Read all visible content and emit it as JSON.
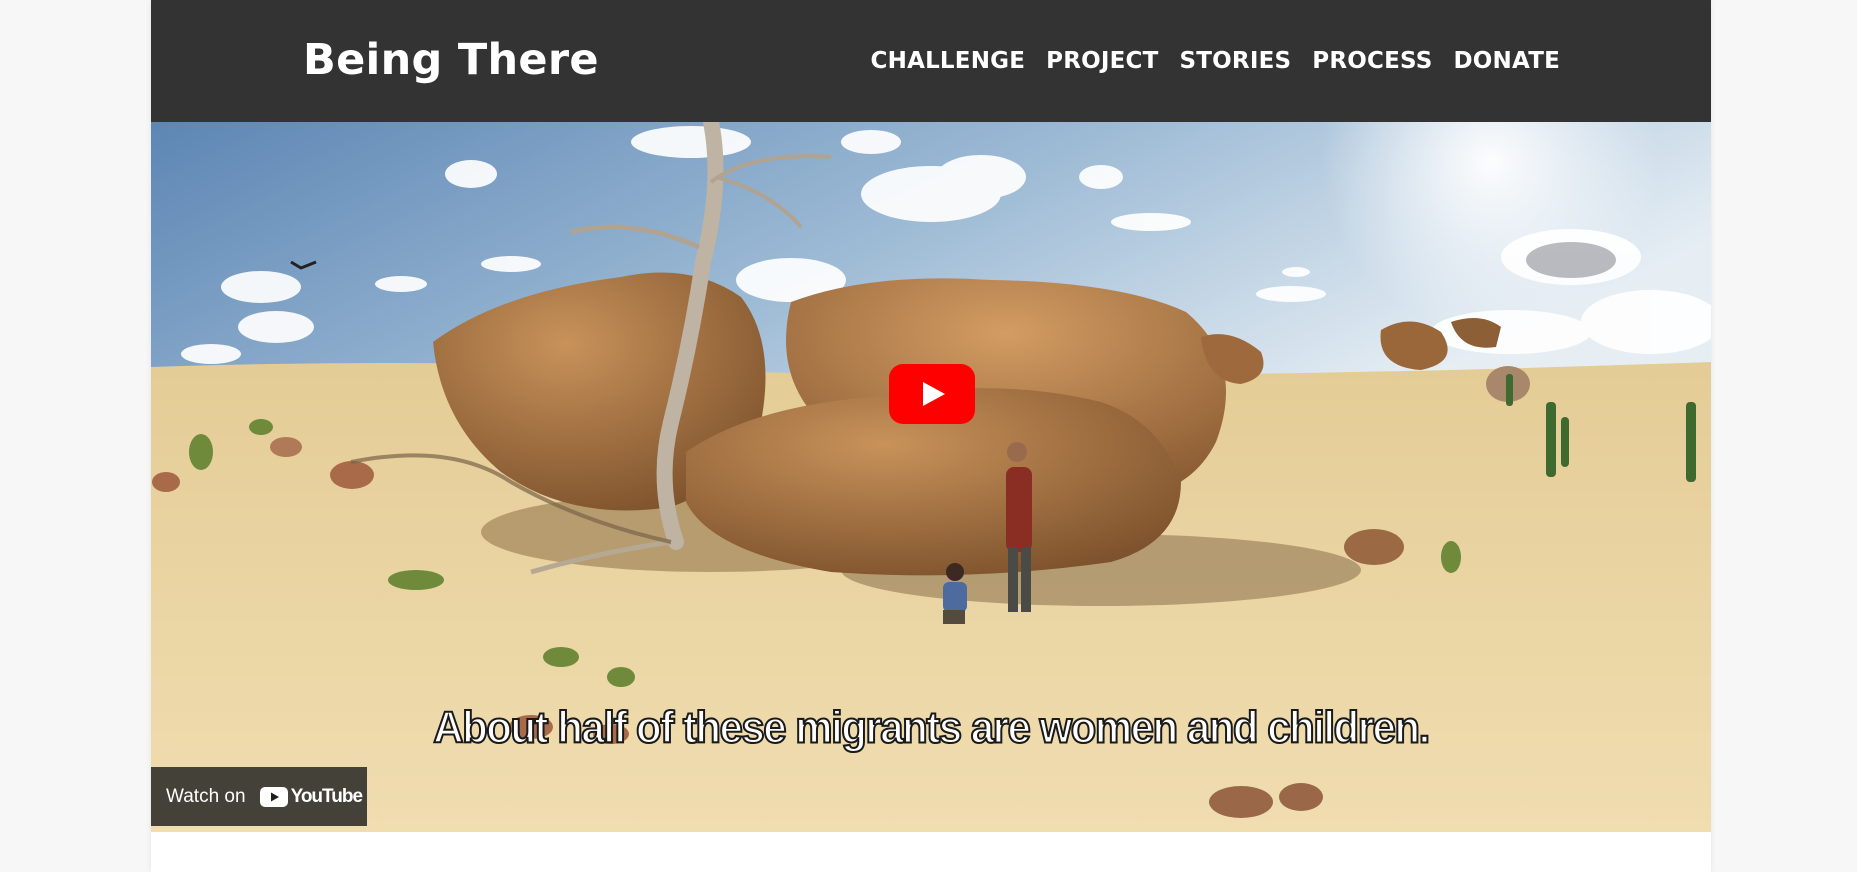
{
  "site": {
    "logo": "Being There",
    "nav": [
      {
        "label": "CHALLENGE"
      },
      {
        "label": "PROJECT"
      },
      {
        "label": "STORIES"
      },
      {
        "label": "PROCESS"
      },
      {
        "label": "DONATE"
      }
    ]
  },
  "video": {
    "subtitle": "About half of these migrants are women and children.",
    "watch_on_label": "Watch on",
    "youtube_label": "YouTube",
    "play_icon": "youtube-play-icon"
  },
  "colors": {
    "header_bg": "#333333",
    "youtube_red": "#ff0000",
    "page_bg": "#f7f7f7"
  }
}
